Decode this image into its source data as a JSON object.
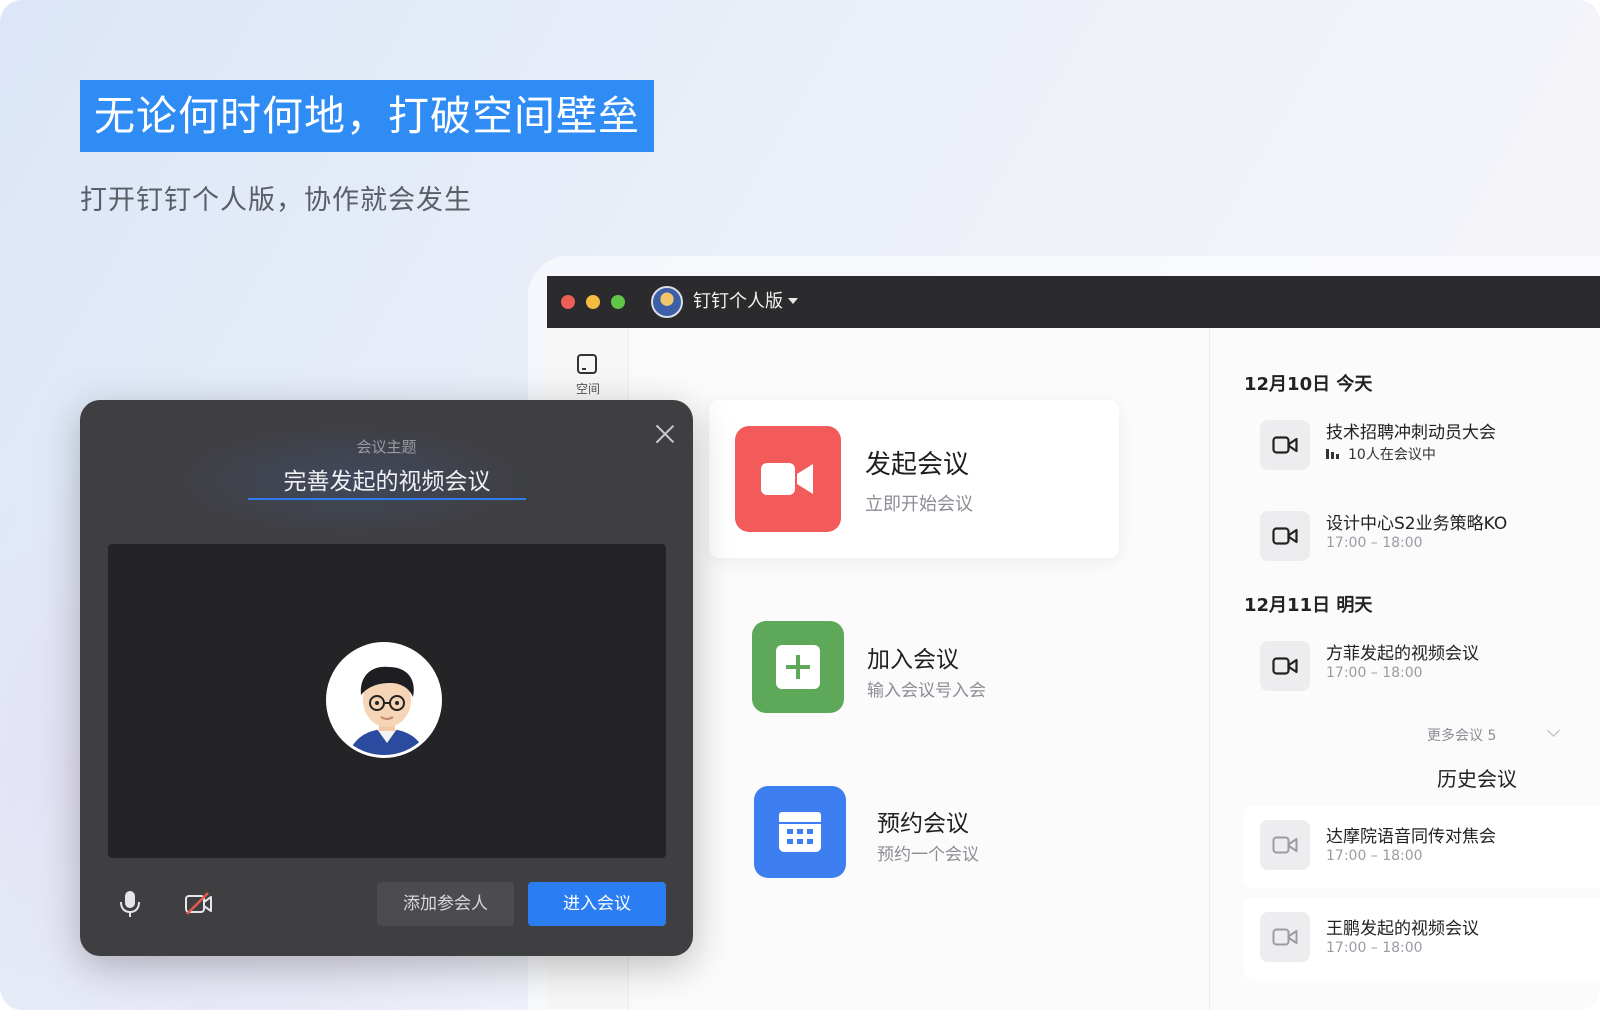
{
  "hero": {
    "headline": "无论何时何地，打破空间壁垒",
    "subline": "打开钉钉个人版，协作就会发生"
  },
  "app": {
    "title": "钉钉个人版",
    "sidebar": {
      "items": [
        {
          "label": "空间",
          "icon": "space-icon"
        }
      ]
    },
    "actions": [
      {
        "title": "发起会议",
        "subtitle": "立即开始会议",
        "icon": "video-camera-icon",
        "color": "#f35b5b"
      },
      {
        "title": "加入会议",
        "subtitle": "输入会议号入会",
        "icon": "plus-icon",
        "color": "#5ea85a"
      },
      {
        "title": "预约会议",
        "subtitle": "预约一个会议",
        "icon": "calendar-icon",
        "color": "#3d7ef0"
      }
    ],
    "schedule": {
      "today": {
        "heading": "12月10日 今天",
        "meetings": [
          {
            "title": "技术招聘冲刺动员大会",
            "status": "10人在会议中"
          },
          {
            "title": "设计中心S2业务策略KO",
            "time": "17:00 – 18:00"
          }
        ]
      },
      "tomorrow": {
        "heading": "12月11日 明天",
        "meetings": [
          {
            "title": "方菲发起的视频会议",
            "time": "17:00 – 18:00"
          }
        ]
      },
      "more_label": "更多会议 5",
      "history_heading": "历史会议",
      "history": [
        {
          "title": "达摩院语音同传对焦会",
          "time": "17:00 – 18:00"
        },
        {
          "title": "王鹏发起的视频会议",
          "time": "17:00 – 18:00"
        }
      ]
    }
  },
  "dialog": {
    "topic_label": "会议主题",
    "topic_value": "完善发起的视频会议",
    "add_participants": "添加参会人",
    "enter_meeting": "进入会议",
    "accent": "#2b7df3"
  }
}
